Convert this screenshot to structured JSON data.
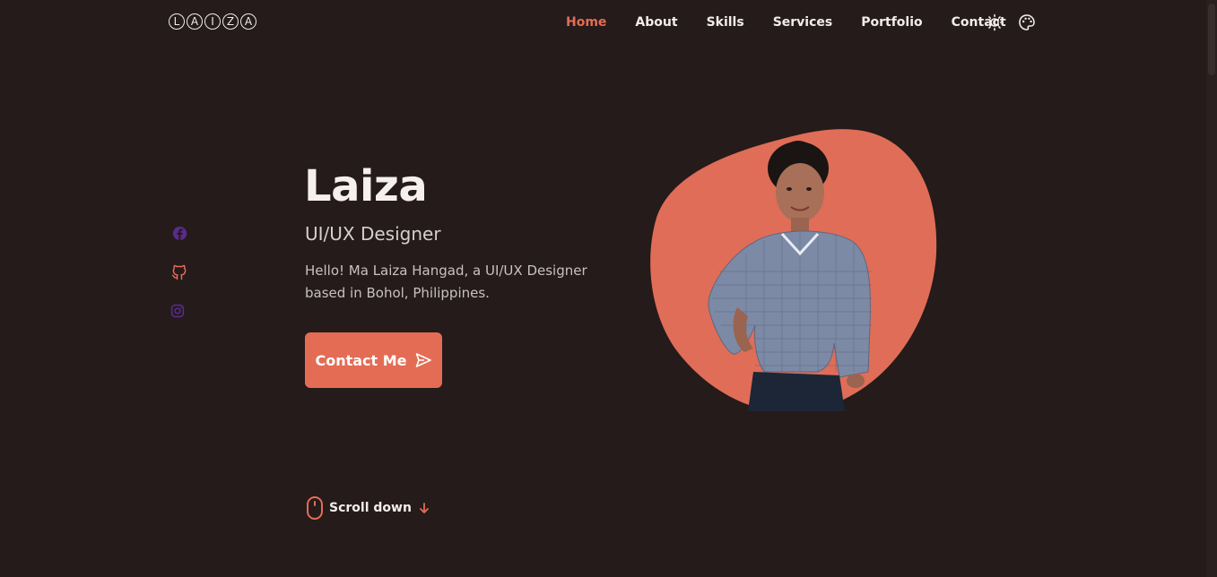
{
  "brand": {
    "logo_letters": [
      "L",
      "A",
      "I",
      "Z",
      "A"
    ]
  },
  "nav": {
    "items": [
      {
        "label": "Home",
        "active": true
      },
      {
        "label": "About",
        "active": false
      },
      {
        "label": "Skills",
        "active": false
      },
      {
        "label": "Services",
        "active": false
      },
      {
        "label": "Portfolio",
        "active": false
      },
      {
        "label": "Contact",
        "active": false
      }
    ],
    "icons": [
      "sun-icon",
      "palette-icon"
    ]
  },
  "socials": [
    {
      "icon": "facebook-icon",
      "color": "#5a2a8c"
    },
    {
      "icon": "github-icon",
      "color": "#e46c55"
    },
    {
      "icon": "instagram-icon",
      "color": "#5a2a8c"
    }
  ],
  "hero": {
    "name": "Laiza",
    "role": "UI/UX Designer",
    "description": "Hello! Ma Laiza Hangad, a UI/UX Designer based in Bohol, Philippines.",
    "cta_label": "Contact Me",
    "cta_icon": "send-icon",
    "image_icon": "profile-photo"
  },
  "scroll": {
    "label": "Scroll down",
    "icons": [
      "mouse-icon",
      "arrow-down-icon"
    ]
  },
  "colors": {
    "background": "#241b1a",
    "accent": "#e46c55",
    "text": "#f2ecea",
    "social_purple": "#5a2a8c"
  }
}
